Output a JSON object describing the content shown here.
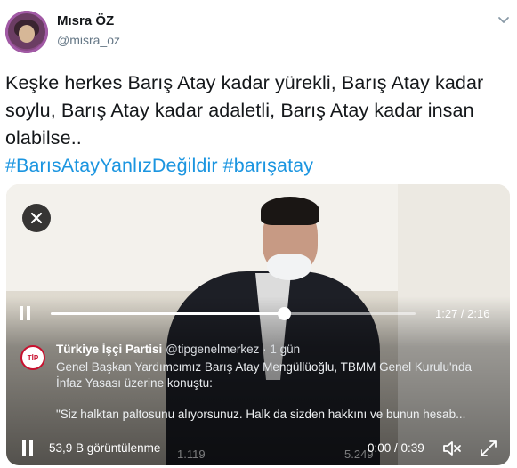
{
  "user": {
    "display_name": "Mısra ÖZ",
    "handle": "@misra_oz"
  },
  "tweet": {
    "text": "Keşke herkes Barış Atay kadar yürekli,  Barış Atay kadar soylu, Barış Atay kadar adaletli, Barış Atay kadar insan olabilse..",
    "hashtags": "#BarısAtayYanlızDeğildir #barışatay"
  },
  "video": {
    "progress": 0.64,
    "time_top": "1:27 / 2:16",
    "embedded_tweet": {
      "name": "Türkiye İşçi Partisi",
      "handle": "@tipgenelmerkez",
      "age": "1 gün",
      "separator": "·",
      "logo_text": "TİP",
      "body": "Genel Başkan Yardımcımız Barış Atay Mengüllüoğlu, TBMM Genel Kurulu'nda İnfaz Yasası üzerine konuştu:",
      "quote": "\"Siz halktan paltosunu alıyorsunuz. Halk da sizden hakkını ve bunun hesab..."
    },
    "faded_retweets": "1.119",
    "faded_likes": "5.249",
    "views": "53,9 B görüntülenme",
    "time_bottom": "0:00 / 0:39"
  },
  "colors": {
    "link": "#1b95e0",
    "avatar_ring": "#a25aa6",
    "tip_red": "#c8102e"
  }
}
